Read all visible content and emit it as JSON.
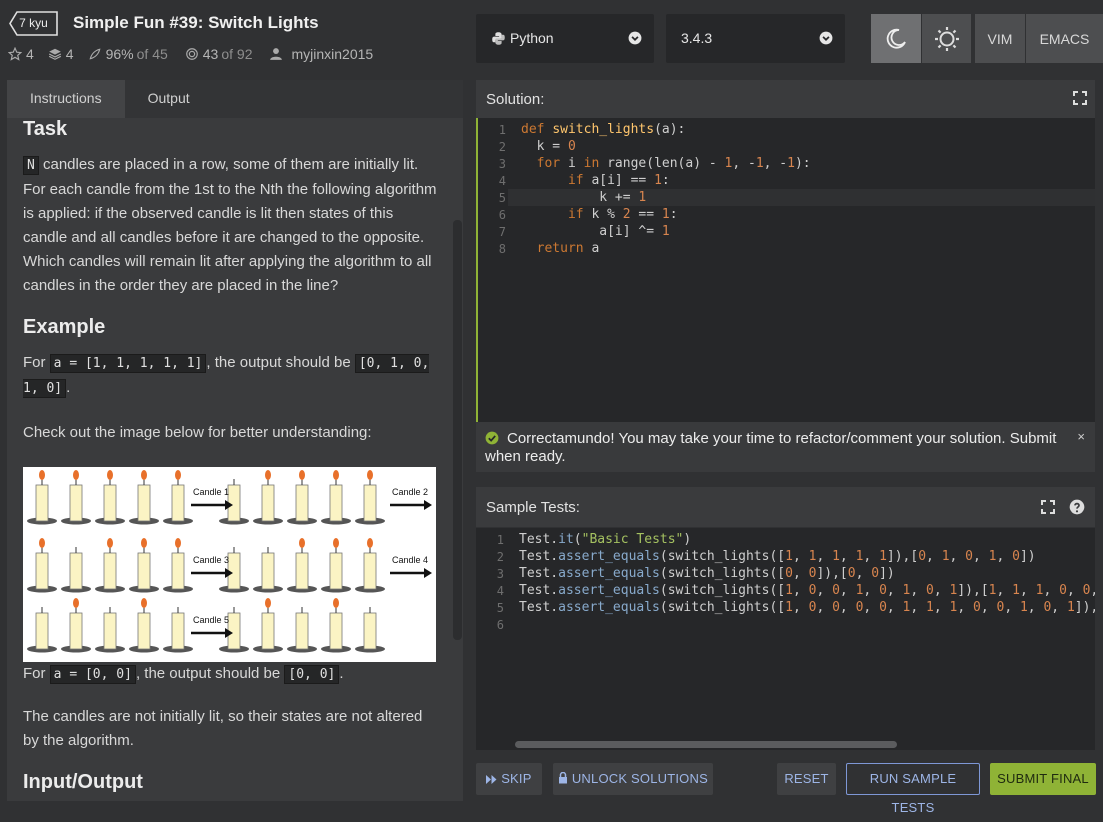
{
  "kata": {
    "rank": "7 kyu",
    "title": "Simple Fun #39: Switch Lights",
    "stats": {
      "stars": "4",
      "collections": "4",
      "satisfaction": "96%",
      "satisfaction_of": "of 45",
      "completed": "43",
      "completed_of": "of 92",
      "author": "myjinxin2015"
    }
  },
  "tabs": [
    "Instructions",
    "Output"
  ],
  "desc": {
    "task_heading": "Task",
    "task_code": "N",
    "task_text": "candles are placed in a row, some of them are initially lit. For each candle from the 1st to the Nth the following algorithm is applied: if the observed candle is lit then states of this candle and all candles before it are changed to the opposite. Which candles will remain lit after applying the algorithm to all candles in the order they are placed in the line?",
    "example_heading": "Example",
    "ex1_for": "For",
    "ex1_code": "a = [1, 1, 1, 1, 1]",
    "ex1_mid": ", the output should be",
    "ex1_out": "[0, 1, 0, 1, 0]",
    "ex1_end": ".",
    "check_text": "Check out the image below for better understanding:",
    "candle_labels": [
      "Candle 1",
      "Candle 2",
      "Candle 3",
      "Candle 4",
      "Candle 5"
    ],
    "ex2_for": "For",
    "ex2_code": "a = [0, 0]",
    "ex2_mid": ", the output should be",
    "ex2_out": "[0, 0]",
    "ex2_end": ".",
    "ex2_text": "The candles are not initially lit, so their states are not altered by the algorithm.",
    "io_heading": "Input/Output"
  },
  "toolbar": {
    "language": "Python",
    "version": "3.4.3",
    "vim": "VIM",
    "emacs": "EMACS"
  },
  "solution": {
    "title": "Solution:",
    "lines": [
      [
        [
          "kw",
          "def "
        ],
        [
          "fn",
          "switch_lights"
        ],
        [
          "",
          "(a):"
        ]
      ],
      [
        [
          "",
          "  k = "
        ],
        [
          "nm",
          "0"
        ]
      ],
      [
        [
          "kw",
          "  for "
        ],
        [
          "",
          "i "
        ],
        [
          "kw",
          "in "
        ],
        [
          "",
          "range(len(a) - "
        ],
        [
          "nm",
          "1"
        ],
        [
          "",
          ", -"
        ],
        [
          "nm",
          "1"
        ],
        [
          "",
          ", -"
        ],
        [
          "nm",
          "1"
        ],
        [
          "",
          "):"
        ]
      ],
      [
        [
          "kw",
          "      if "
        ],
        [
          "",
          "a[i] == "
        ],
        [
          "nm",
          "1"
        ],
        [
          "",
          ":"
        ]
      ],
      [
        [
          "",
          "          k += "
        ],
        [
          "nm",
          "1"
        ]
      ],
      [
        [
          "kw",
          "      if "
        ],
        [
          "",
          "k % "
        ],
        [
          "nm",
          "2"
        ],
        [
          "",
          ", == "
        ],
        [
          "nm",
          "1"
        ],
        [
          "",
          ":"
        ]
      ],
      [
        [
          "",
          "          a[i] ^= "
        ],
        [
          "nm",
          "1"
        ]
      ],
      [
        [
          "kw",
          "  return "
        ],
        [
          "",
          "a"
        ]
      ]
    ]
  },
  "banner": {
    "text": "Correctamundo! You may take your time to refactor/comment your solution. Submit when ready.",
    "close": "×"
  },
  "tests": {
    "title": "Sample Tests:",
    "lines": [
      [
        [
          "",
          "Test."
        ],
        [
          "mt",
          "it"
        ],
        [
          "",
          "("
        ],
        [
          "st",
          "\"Basic Tests\""
        ],
        [
          "",
          ")"
        ]
      ],
      [
        [
          "",
          "Test."
        ],
        [
          "mt",
          "assert_equals"
        ],
        [
          "",
          "(switch_lights(["
        ],
        [
          "nm",
          "1"
        ],
        [
          "",
          ", "
        ],
        [
          "nm",
          "1"
        ],
        [
          "",
          ", "
        ],
        [
          "nm",
          "1"
        ],
        [
          "",
          ", "
        ],
        [
          "nm",
          "1"
        ],
        [
          "",
          ", "
        ],
        [
          "nm",
          "1"
        ],
        [
          "",
          "]),["
        ],
        [
          "nm",
          "0"
        ],
        [
          "",
          ", "
        ],
        [
          "nm",
          "1"
        ],
        [
          "",
          ", "
        ],
        [
          "nm",
          "0"
        ],
        [
          "",
          ", "
        ],
        [
          "nm",
          "1"
        ],
        [
          "",
          ", "
        ],
        [
          "nm",
          "0"
        ],
        [
          "",
          "])"
        ]
      ],
      [
        [
          "",
          "Test."
        ],
        [
          "mt",
          "assert_equals"
        ],
        [
          "",
          "(switch_lights(["
        ],
        [
          "nm",
          "0"
        ],
        [
          "",
          ", "
        ],
        [
          "nm",
          "0"
        ],
        [
          "",
          "]),["
        ],
        [
          "nm",
          "0"
        ],
        [
          "",
          ", "
        ],
        [
          "nm",
          "0"
        ],
        [
          "",
          "])"
        ]
      ],
      [
        [
          "",
          "Test."
        ],
        [
          "mt",
          "assert_equals"
        ],
        [
          "",
          "(switch_lights(["
        ],
        [
          "nm",
          "1"
        ],
        [
          "",
          ", "
        ],
        [
          "nm",
          "0"
        ],
        [
          "",
          ", "
        ],
        [
          "nm",
          "0"
        ],
        [
          "",
          ", "
        ],
        [
          "nm",
          "1"
        ],
        [
          "",
          ", "
        ],
        [
          "nm",
          "0"
        ],
        [
          "",
          ", "
        ],
        [
          "nm",
          "1"
        ],
        [
          "",
          ", "
        ],
        [
          "nm",
          "0"
        ],
        [
          "",
          ", "
        ],
        [
          "nm",
          "1"
        ],
        [
          "",
          "]),["
        ],
        [
          "nm",
          "1"
        ],
        [
          "",
          ", "
        ],
        [
          "nm",
          "1"
        ],
        [
          "",
          ", "
        ],
        [
          "nm",
          "1"
        ],
        [
          "",
          ", "
        ],
        [
          "nm",
          "0"
        ],
        [
          "",
          ", "
        ],
        [
          "nm",
          "0"
        ],
        [
          "",
          ", "
        ]
      ],
      [
        [
          "",
          "Test."
        ],
        [
          "mt",
          "assert_equals"
        ],
        [
          "",
          "(switch_lights(["
        ],
        [
          "nm",
          "1"
        ],
        [
          "",
          ", "
        ],
        [
          "nm",
          "0"
        ],
        [
          "",
          ", "
        ],
        [
          "nm",
          "0"
        ],
        [
          "",
          ", "
        ],
        [
          "nm",
          "0"
        ],
        [
          "",
          ", "
        ],
        [
          "nm",
          "0"
        ],
        [
          "",
          ", "
        ],
        [
          "nm",
          "1"
        ],
        [
          "",
          ", "
        ],
        [
          "nm",
          "1"
        ],
        [
          "",
          ", "
        ],
        [
          "nm",
          "1"
        ],
        [
          "",
          ", "
        ],
        [
          "nm",
          "0"
        ],
        [
          "",
          ", "
        ],
        [
          "nm",
          "0"
        ],
        [
          "",
          ", "
        ],
        [
          "nm",
          "1"
        ],
        [
          "",
          ", "
        ],
        [
          "nm",
          "0"
        ],
        [
          "",
          ", "
        ],
        [
          "nm",
          "1"
        ],
        [
          "",
          "]),["
        ]
      ],
      []
    ]
  },
  "buttons": {
    "skip": "SKIP",
    "unlock": "UNLOCK SOLUTIONS",
    "reset": "RESET",
    "run": "RUN SAMPLE TESTS",
    "submit": "SUBMIT FINAL"
  }
}
